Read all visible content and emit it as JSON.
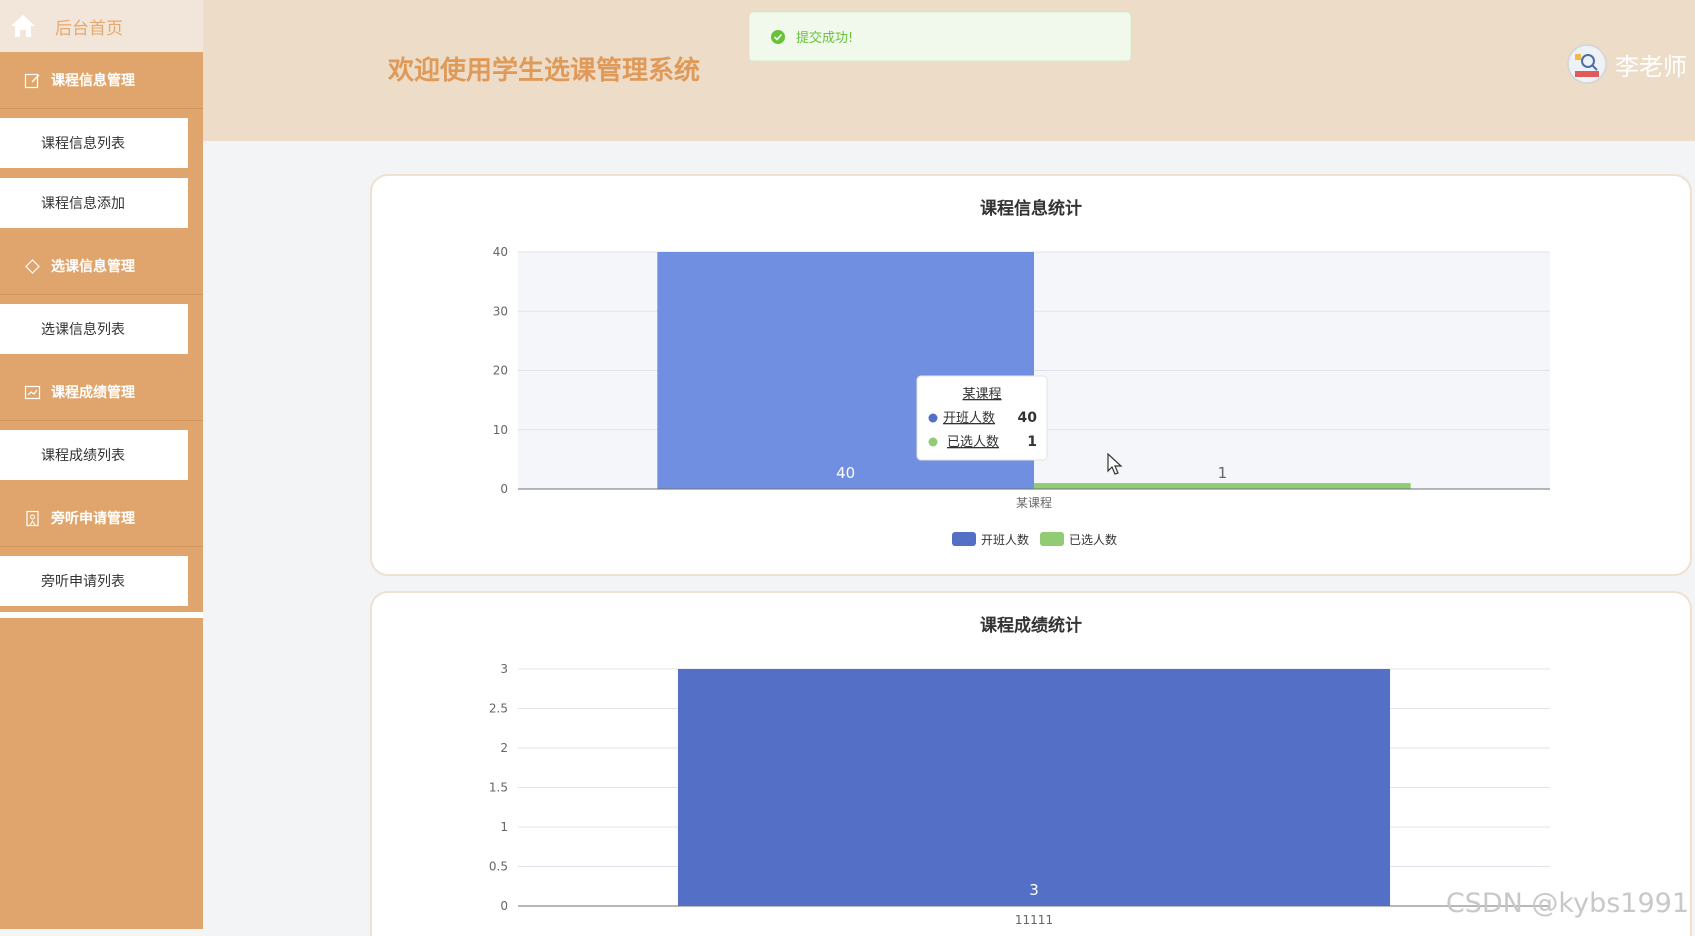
{
  "sidebar": {
    "home_label": "后台首页",
    "groups": [
      {
        "label": "课程信息管理",
        "icon": "edit-icon",
        "items": [
          "课程信息列表",
          "课程信息添加"
        ]
      },
      {
        "label": "选课信息管理",
        "icon": "tag-icon",
        "items": [
          "选课信息列表"
        ]
      },
      {
        "label": "课程成绩管理",
        "icon": "chart-icon",
        "items": [
          "课程成绩列表"
        ]
      },
      {
        "label": "旁听申请管理",
        "icon": "doc-icon",
        "items": [
          "旁听申请列表"
        ]
      }
    ]
  },
  "header": {
    "title": "欢迎使用学生选课管理系统",
    "user_name": "李老师"
  },
  "toast": {
    "text": "提交成功!"
  },
  "colors": {
    "accent": "#dfa56c",
    "series_blue": "#5470c6",
    "series_green": "#91cc75"
  },
  "chart_data": [
    {
      "type": "bar",
      "title": "课程信息统计",
      "categories": [
        "某课程"
      ],
      "series": [
        {
          "name": "开班人数",
          "values": [
            40
          ]
        },
        {
          "name": "已选人数",
          "values": [
            1
          ]
        }
      ],
      "ylim": [
        0,
        40
      ],
      "yticks": [
        0,
        10,
        20,
        30,
        40
      ],
      "legend": "bottom-center",
      "tooltip": {
        "title": "某课程",
        "rows": [
          {
            "name": "开班人数",
            "value": "40"
          },
          {
            "name": "已选人数",
            "value": "1"
          }
        ]
      }
    },
    {
      "type": "bar",
      "title": "课程成绩统计",
      "categories": [
        "11111"
      ],
      "series": [
        {
          "values": [
            3
          ]
        }
      ],
      "ylim": [
        0,
        3
      ],
      "yticks": [
        0,
        0.5,
        1,
        1.5,
        2,
        2.5,
        3
      ]
    }
  ],
  "watermark": "CSDN @kybs1991"
}
